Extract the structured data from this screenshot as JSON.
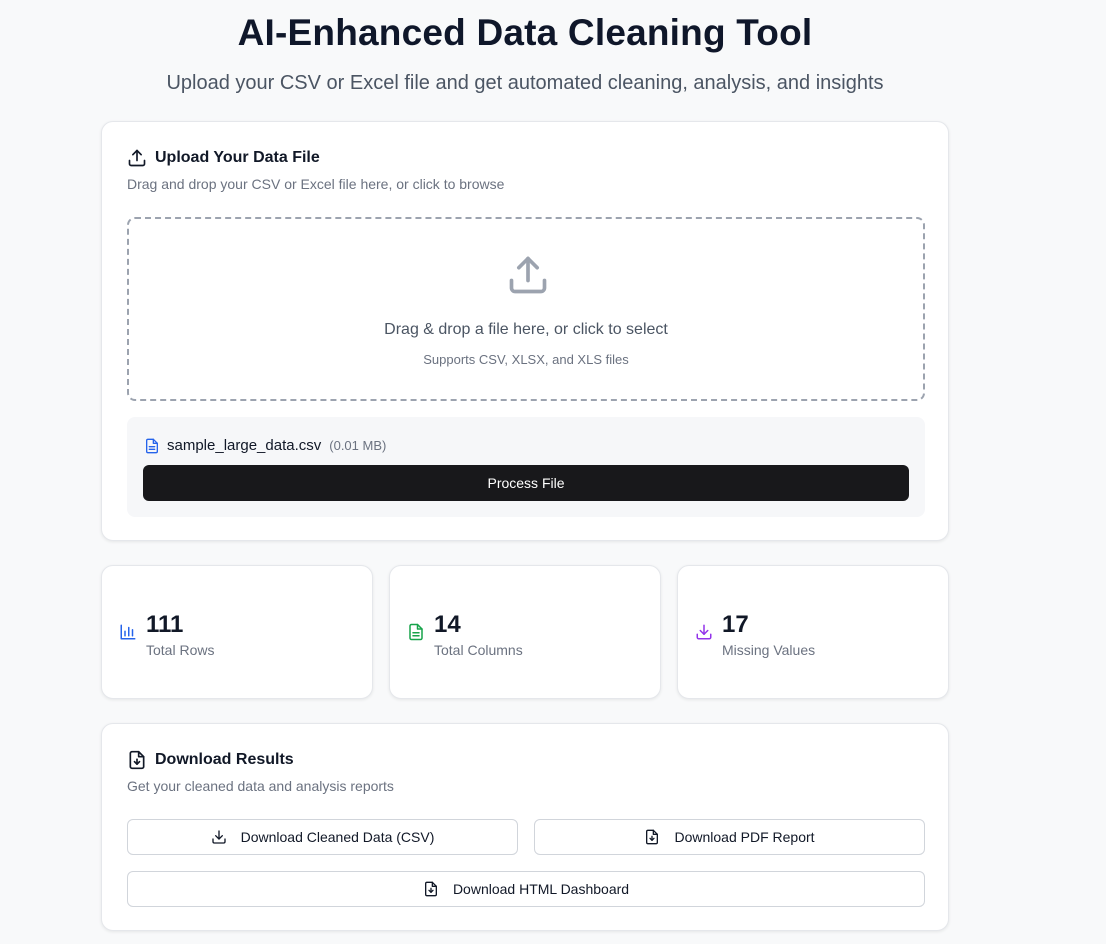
{
  "header": {
    "title": "AI-Enhanced Data Cleaning Tool",
    "subtitle": "Upload your CSV or Excel file and get automated cleaning, analysis, and insights"
  },
  "upload": {
    "title": "Upload Your Data File",
    "description": "Drag and drop your CSV or Excel file here, or click to browse",
    "dropzone_main": "Drag & drop a file here, or click to select",
    "dropzone_sub": "Supports CSV, XLSX, and XLS files",
    "file_name": "sample_large_data.csv",
    "file_size": "(0.01 MB)",
    "process_label": "Process File"
  },
  "stats": [
    {
      "value": "111",
      "label": "Total Rows",
      "icon": "bar-chart-icon",
      "color": "#2563eb"
    },
    {
      "value": "14",
      "label": "Total Columns",
      "icon": "file-text-icon",
      "color": "#16a34a"
    },
    {
      "value": "17",
      "label": "Missing Values",
      "icon": "download-tray-icon",
      "color": "#9333ea"
    }
  ],
  "download": {
    "title": "Download Results",
    "description": "Get your cleaned data and analysis reports",
    "csv_label": "Download Cleaned Data (CSV)",
    "pdf_label": "Download PDF Report",
    "html_label": "Download HTML Dashboard"
  },
  "colors": {
    "accent_blue": "#2563eb",
    "accent_green": "#16a34a",
    "accent_purple": "#9333ea",
    "button_dark": "#18181b"
  }
}
